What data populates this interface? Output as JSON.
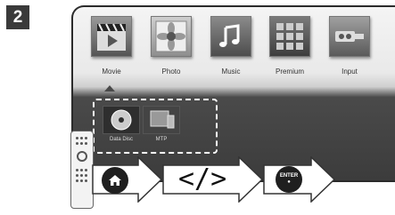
{
  "step": {
    "number": "2"
  },
  "home_menu": {
    "items": [
      {
        "label": "Movie",
        "icon": "movie-clapper-icon"
      },
      {
        "label": "Photo",
        "icon": "photo-flower-icon"
      },
      {
        "label": "Music",
        "icon": "music-note-icon"
      },
      {
        "label": "Premium",
        "icon": "premium-grid-icon"
      },
      {
        "label": "Input",
        "icon": "input-plug-icon"
      }
    ]
  },
  "submenu": {
    "items": [
      {
        "label": "Data Disc",
        "icon": "disc-icon"
      },
      {
        "label": "MTP",
        "icon": "device-icon"
      }
    ]
  },
  "instructions": {
    "keys": [
      {
        "icon": "home-icon"
      },
      {
        "glyph": "</>"
      },
      {
        "label": "ENTER",
        "icon": "enter-key-icon"
      }
    ]
  }
}
